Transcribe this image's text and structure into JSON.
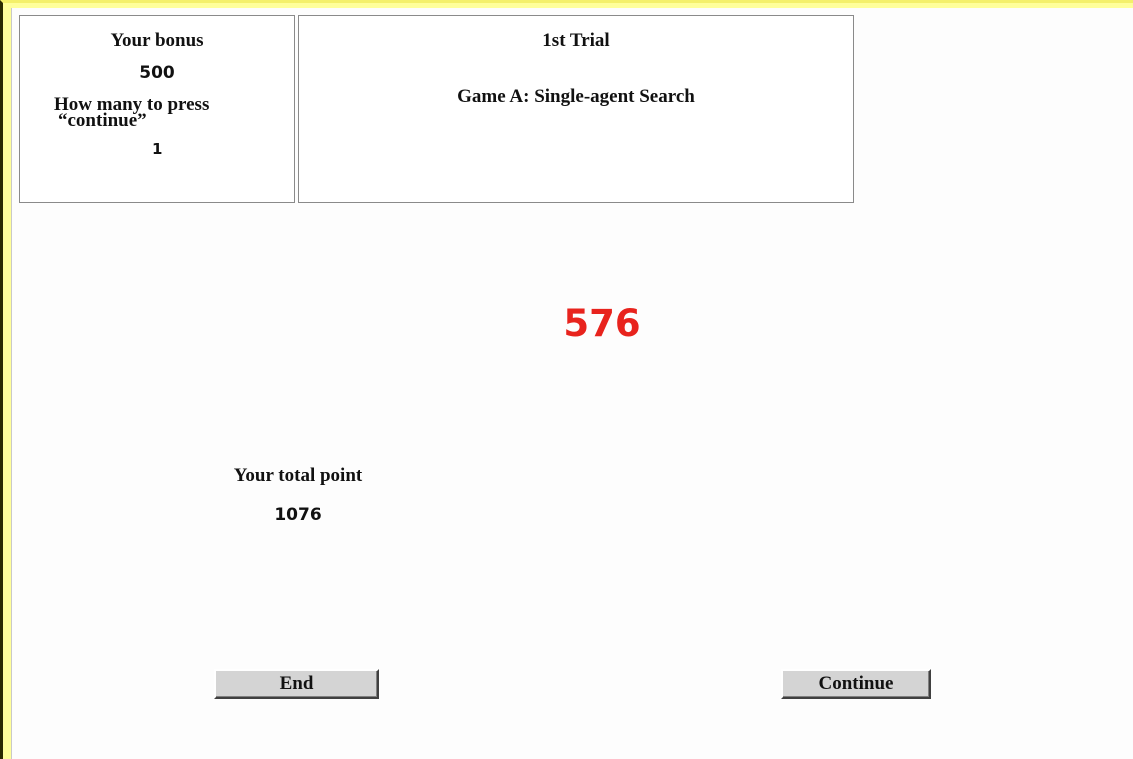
{
  "bonus_panel": {
    "bonus_label": "Your bonus",
    "bonus_value": "500",
    "press_label_line1": "How many to press",
    "press_label_line2": "“continue”",
    "press_value": "1"
  },
  "info_panel": {
    "trial": "1st Trial",
    "game": "Game A: Single-agent Search"
  },
  "current_score": {
    "value": "576",
    "color": "#e8231d"
  },
  "total": {
    "label": "Your total point",
    "value": "1076"
  },
  "buttons": {
    "end_label": "End",
    "continue_label": "Continue"
  }
}
